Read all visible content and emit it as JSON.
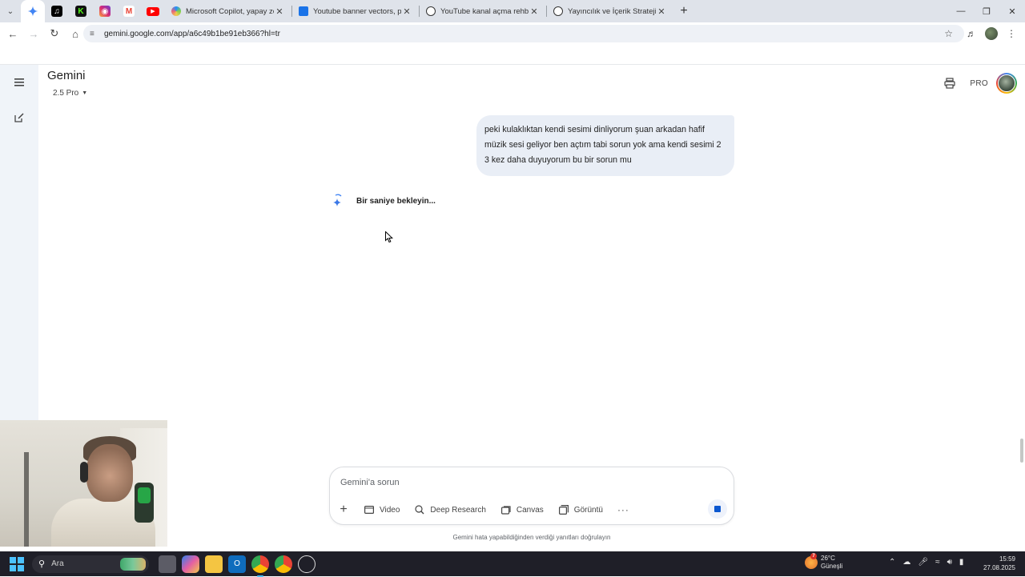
{
  "browser": {
    "pinned_tabs": [
      {
        "icon": "gemini-icon",
        "color": "#4285f4",
        "active": true
      },
      {
        "icon": "tiktok-icon",
        "color": "#000000"
      },
      {
        "icon": "kick-icon",
        "color": "#53fc18"
      },
      {
        "icon": "instagram-icon",
        "color": "#d62976"
      },
      {
        "icon": "gmail-icon",
        "color": "#ea4335"
      },
      {
        "icon": "youtube-icon",
        "color": "#ff0000"
      }
    ],
    "tabs": [
      {
        "title": "Microsoft Copilot, yapay zeka e",
        "icon": "copilot-icon"
      },
      {
        "title": "Youtube banner vectors, photo",
        "icon": "docs-icon"
      },
      {
        "title": "YouTube kanal açma rehberi",
        "icon": "openai-icon"
      },
      {
        "title": "Yayıncılık ve İçerik Stratejisi Öne",
        "icon": "openai-icon"
      }
    ],
    "url": "gemini.google.com/app/a6c49b1be91eb366?hl=tr"
  },
  "app": {
    "name": "Gemini",
    "model": "2.5 Pro",
    "plan_badge": "PRO"
  },
  "chat": {
    "user_message": "peki kulaklıktan kendi sesimi dinliyorum şuan arkadan hafif müzik sesi geliyor ben açtım tabi sorun yok ama kendi sesimi 2 3 kez daha duyuyorum bu bir sorun mu",
    "status": "Bir saniye bekleyin..."
  },
  "composer": {
    "placeholder": "Gemini'a sorun",
    "tools": [
      {
        "label": "Video",
        "icon": "video-icon"
      },
      {
        "label": "Deep Research",
        "icon": "deep-research-icon"
      },
      {
        "label": "Canvas",
        "icon": "canvas-icon"
      },
      {
        "label": "Görüntü",
        "icon": "image-icon"
      }
    ],
    "disclaimer": "Gemini hata yapabildiğinden verdiği yanıtları doğrulayın"
  },
  "taskbar": {
    "search_label": "Ara",
    "weather": {
      "temp": "26°C",
      "condition": "Güneşli",
      "badge": "7"
    },
    "time": "15:59",
    "date": "27.08.2025"
  },
  "colors": {
    "accent": "#0b57d0",
    "bubble": "#e9eef6",
    "rail": "#f0f4f9"
  }
}
